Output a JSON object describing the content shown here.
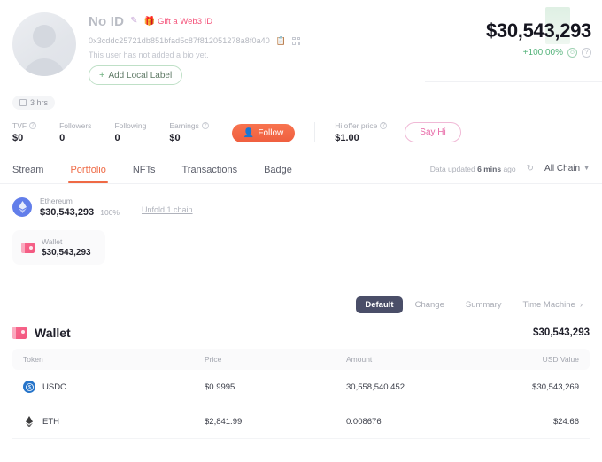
{
  "profile": {
    "name": "No ID",
    "edit_icon": "pencil-icon",
    "gift_label": "Gift a Web3 ID",
    "gift_icon": "gift-icon",
    "address": "0x3cddc25721db851bfad5c87f812051278a8f0a40",
    "copy_icon": "copy-icon",
    "qr_icon": "qr-code-icon",
    "bio": "This user has not added a bio yet.",
    "add_label_button": "Add Local Label",
    "add_label_plus": "+",
    "time_badge": "3 hrs",
    "time_badge_icon": "calendar-icon"
  },
  "balance": {
    "total": "$30,543,293",
    "change_pct": "+100.00%",
    "change_color": "#54b37a",
    "smiley_icon": "smiley-icon",
    "help_icon": "question-circle-icon"
  },
  "stats": [
    {
      "label": "TVF",
      "value": "$0",
      "has_help": true
    },
    {
      "label": "Followers",
      "value": "0",
      "has_help": false
    },
    {
      "label": "Following",
      "value": "0",
      "has_help": false
    },
    {
      "label": "Earnings",
      "value": "$0",
      "has_help": true
    }
  ],
  "actions": {
    "follow_label": "Follow",
    "follow_icon": "person-add-icon",
    "follow_color": "#ef5f3f",
    "hi_offer_label": "Hi offer price",
    "hi_offer_value": "$1.00",
    "say_hi_label": "Say Hi",
    "say_hi_color": "#e86aa8"
  },
  "tabs": [
    {
      "label": "Stream",
      "active": false
    },
    {
      "label": "Portfolio",
      "active": true
    },
    {
      "label": "NFTs",
      "active": false
    },
    {
      "label": "Transactions",
      "active": false
    },
    {
      "label": "Badge",
      "active": false
    }
  ],
  "tabs_right": {
    "updated_prefix": "Data updated",
    "updated_value": "6 mins",
    "updated_suffix": "ago",
    "refresh_icon": "refresh-icon",
    "chain_filter": "All Chain",
    "chevron_icon": "chevron-down-icon"
  },
  "chain": {
    "icon": "ethereum-icon",
    "name": "Ethereum",
    "amount": "$30,543,293",
    "percent": "100%",
    "unfold_link": "Unfold 1 chain"
  },
  "wallet_chip": {
    "icon": "wallet-icon",
    "name": "Wallet",
    "amount": "$30,543,293"
  },
  "view_toggle": [
    {
      "label": "Default",
      "active": true
    },
    {
      "label": "Change",
      "active": false
    },
    {
      "label": "Summary",
      "active": false
    },
    {
      "label": "Time Machine",
      "active": false,
      "chevron": "›"
    }
  ],
  "wallet_section": {
    "icon": "wallet-icon",
    "title": "Wallet",
    "total": "$30,543,293",
    "columns": [
      "Token",
      "Price",
      "Amount",
      "USD Value"
    ],
    "rows": [
      {
        "icon": "usdc-icon",
        "token": "USDC",
        "price": "$0.9995",
        "amount": "30,558,540.452",
        "usd_value": "$30,543,269"
      },
      {
        "icon": "ethereum-icon",
        "token": "ETH",
        "price": "$2,841.99",
        "amount": "0.008676",
        "usd_value": "$24.66"
      }
    ]
  }
}
